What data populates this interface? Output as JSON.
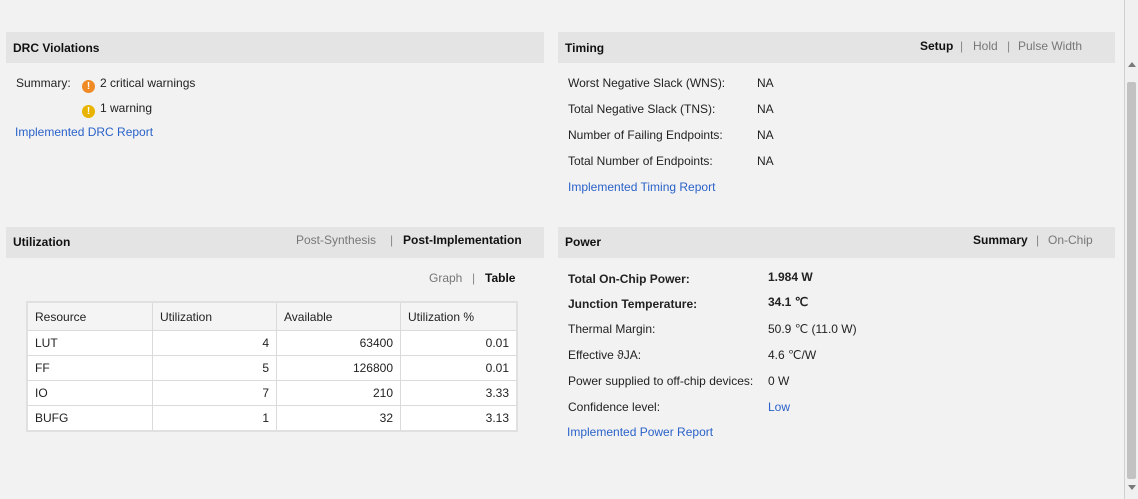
{
  "drc": {
    "title": "DRC Violations",
    "summary_label": "Summary:",
    "critical_warnings": "2 critical warnings",
    "warnings": "1 warning",
    "report_link": "Implemented DRC Report",
    "critical_color": "#f08a24",
    "warning_color": "#e8b400"
  },
  "timing": {
    "title": "Timing",
    "tabs": [
      "Setup",
      "Hold",
      "Pulse Width"
    ],
    "rows": [
      {
        "label": "Worst Negative Slack (WNS):",
        "value": "NA"
      },
      {
        "label": "Total Negative Slack (TNS):",
        "value": "NA"
      },
      {
        "label": "Number of Failing Endpoints:",
        "value": "NA"
      },
      {
        "label": "Total Number of Endpoints:",
        "value": "NA"
      }
    ],
    "report_link": "Implemented Timing Report"
  },
  "utilization": {
    "title": "Utilization",
    "tabs": [
      "Post-Synthesis",
      "Post-Implementation"
    ],
    "view_tabs": [
      "Graph",
      "Table"
    ],
    "columns": [
      "Resource",
      "Utilization",
      "Available",
      "Utilization %"
    ],
    "rows": [
      [
        "LUT",
        "4",
        "63400",
        "0.01"
      ],
      [
        "FF",
        "5",
        "126800",
        "0.01"
      ],
      [
        "IO",
        "7",
        "210",
        "3.33"
      ],
      [
        "BUFG",
        "1",
        "32",
        "3.13"
      ]
    ]
  },
  "power": {
    "title": "Power",
    "tabs": [
      "Summary",
      "On-Chip"
    ],
    "rows": [
      {
        "label": "Total On-Chip Power:",
        "value": "1.984 W"
      },
      {
        "label": "Junction Temperature:",
        "value": "34.1 ℃"
      },
      {
        "label": "Thermal Margin:",
        "value": "50.9 ℃ (11.0 W)"
      },
      {
        "label": "Effective ϑJA:",
        "value": "4.6 ℃/W"
      },
      {
        "label": "Power supplied to off-chip devices:",
        "value": "0 W"
      },
      {
        "label": "Confidence level:",
        "value": "Low"
      }
    ],
    "report_link": "Implemented Power Report"
  },
  "separator": "|",
  "link_color": "#2a62c9"
}
